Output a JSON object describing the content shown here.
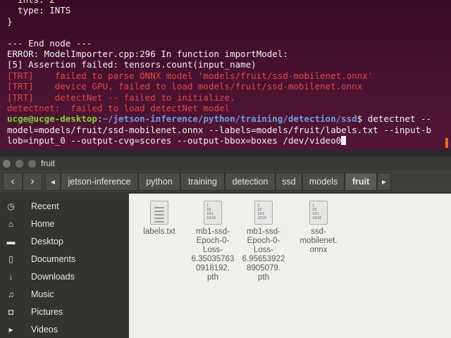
{
  "terminal": {
    "lines": [
      {
        "segments": [
          {
            "text": "  ints: 2",
            "cls": ""
          }
        ]
      },
      {
        "segments": [
          {
            "text": "  type: INTS",
            "cls": ""
          }
        ]
      },
      {
        "segments": [
          {
            "text": "}",
            "cls": ""
          }
        ]
      },
      {
        "segments": [
          {
            "text": "",
            "cls": ""
          }
        ]
      },
      {
        "segments": [
          {
            "text": "--- End node ---",
            "cls": ""
          }
        ]
      },
      {
        "segments": [
          {
            "text": "ERROR: ModelImporter.cpp:296 In function importModel:",
            "cls": ""
          }
        ]
      },
      {
        "segments": [
          {
            "text": "[5] Assertion failed: tensors.count(input_name)",
            "cls": ""
          }
        ]
      },
      {
        "segments": [
          {
            "text": "[TRT]    failed to parse ONNX model 'models/fruit/ssd-mobilenet.onnx'",
            "cls": "red"
          }
        ]
      },
      {
        "segments": [
          {
            "text": "[TRT]    device GPU, failed to load models/fruit/ssd-mobilenet.onnx",
            "cls": "red"
          }
        ]
      },
      {
        "segments": [
          {
            "text": "[TRT]    detectNet -- failed to initialize.",
            "cls": "red"
          }
        ]
      },
      {
        "segments": [
          {
            "text": "detectnet:  failed to load detectNet model",
            "cls": "red"
          }
        ]
      },
      {
        "segments": [
          {
            "text": "ucge@ucge-desktop",
            "cls": "prompt-user"
          },
          {
            "text": ":",
            "cls": ""
          },
          {
            "text": "~/jetson-inference/python/training/detection/ssd",
            "cls": "prompt-path"
          },
          {
            "text": "$ detectnet --",
            "cls": ""
          }
        ]
      },
      {
        "segments": [
          {
            "text": "model=models/fruit/ssd-mobilenet.onnx --labels=models/fruit/labels.txt --input-b",
            "cls": ""
          }
        ]
      },
      {
        "segments": [
          {
            "text": "lob=input_0 --output-cvg=scores --output-bbox=boxes /dev/video0",
            "cls": ""
          }
        ]
      }
    ]
  },
  "window": {
    "title": "fruit"
  },
  "toolbar": {
    "back": "‹",
    "forward": "›",
    "crumb_prev": "◂",
    "crumb_next": "▸",
    "breadcrumbs": [
      "jetson-inference",
      "python",
      "training",
      "detection",
      "ssd",
      "models",
      "fruit"
    ]
  },
  "sidebar": {
    "items": [
      {
        "label": "Recent",
        "icon": "clock-icon",
        "glyph": "◷"
      },
      {
        "label": "Home",
        "icon": "home-icon",
        "glyph": "⌂"
      },
      {
        "label": "Desktop",
        "icon": "folder-icon",
        "glyph": "▬"
      },
      {
        "label": "Documents",
        "icon": "document-icon",
        "glyph": "▯"
      },
      {
        "label": "Downloads",
        "icon": "download-icon",
        "glyph": "↓"
      },
      {
        "label": "Music",
        "icon": "music-icon",
        "glyph": "♫"
      },
      {
        "label": "Pictures",
        "icon": "camera-icon",
        "glyph": "◘"
      },
      {
        "label": "Videos",
        "icon": "video-icon",
        "glyph": "▸"
      }
    ]
  },
  "files": [
    {
      "name": "labels.txt",
      "kind": "txt"
    },
    {
      "name": "mb1-ssd-\nEpoch-0-\nLoss-\n6.35035763\n0918192.\npth",
      "kind": "bin"
    },
    {
      "name": "mb1-ssd-\nEpoch-0-\nLoss-\n6.95653922\n8905079.\npth",
      "kind": "bin"
    },
    {
      "name": "ssd-\nmobilenet.\nonnx",
      "kind": "bin"
    }
  ],
  "bin_icon_text": "1\n10\n101\n1010",
  "colors": {
    "terminal_bg": "#4a1230",
    "error_red": "#e4474a",
    "prompt_green": "#7fd33b",
    "prompt_blue": "#6f9fe8"
  }
}
